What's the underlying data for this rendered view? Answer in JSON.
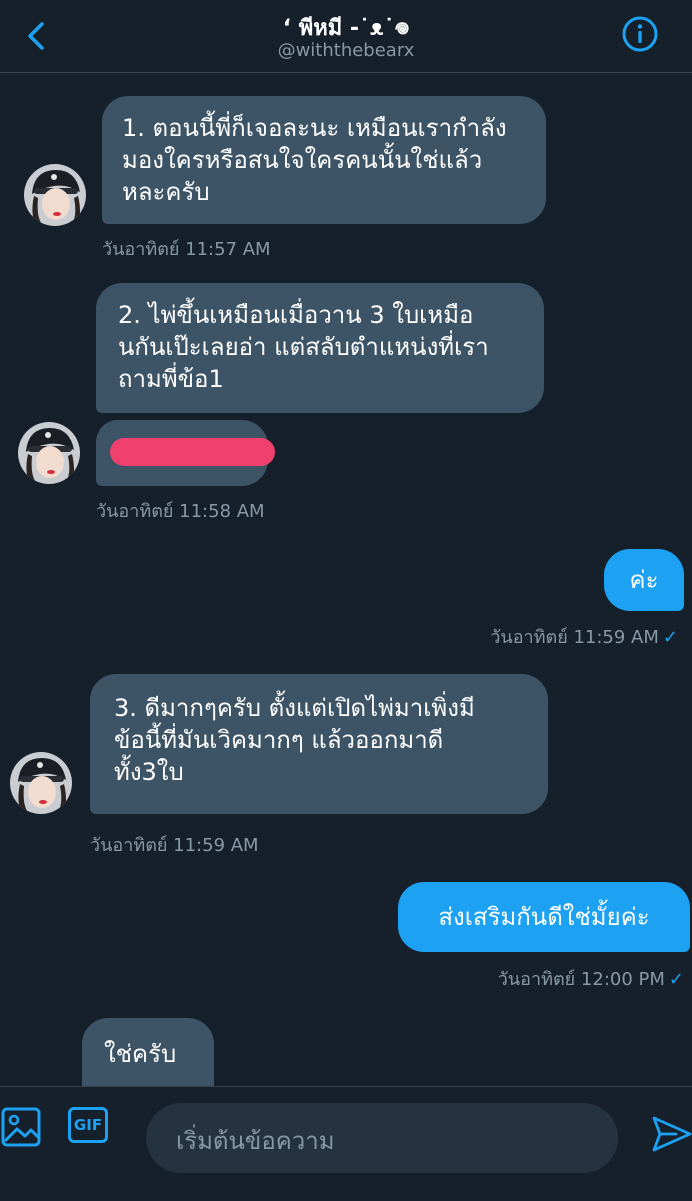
{
  "header": {
    "title": "ʻ พีหมี -˙ᴥ˙𖦹",
    "handle": "@withthebearx"
  },
  "messages": [
    {
      "lines": [
        "1. ตอนนี้พี่ก็เจอละนะ เหมือนเรากำลัง",
        "มองใครหรือสนใจใครคนนั้นใช่แล้ว",
        "หละครับ"
      ],
      "timestamp": "วันอาทิตย์ 11:57 AM"
    },
    {
      "lines": [
        "2. ไพ่ขึ้นเหมือนเมื่อวาน 3 ใบเหมือ",
        "นกันเป๊ะเลยอ่า แต่สลับตำแหน่งที่เรา",
        "ถามพี่ข้อ1"
      ],
      "timestamp": "วันอาทิตย์ 11:58 AM"
    },
    {
      "lines": [
        "ค่ะ"
      ],
      "timestamp": "วันอาทิตย์ 11:59 AM"
    },
    {
      "lines": [
        "3. ดีมากๆครับ ตั้งแต่เปิดไพ่มาเพิ่งมี",
        "ข้อนี้ที่มันเวิคมากๆ แล้วออกมาดี",
        "ทั้ง3ใบ"
      ],
      "timestamp": "วันอาทิตย์ 11:59 AM"
    },
    {
      "lines": [
        "ส่งเสริมกันดีใช่มั้ยค่ะ"
      ],
      "timestamp": "วันอาทิตย์ 12:00 PM"
    },
    {
      "lines": [
        "ใช่ครับ"
      ]
    }
  ],
  "read_check": "✓",
  "composer": {
    "gif_label": "GIF",
    "placeholder": "เริ่มต้นข้อความ"
  },
  "colors": {
    "background": "#15202b",
    "incoming_bubble": "#3d5466",
    "outgoing_bubble": "#1da1f2",
    "accent": "#1da1f2",
    "muted_text": "#8899a6",
    "redaction": "#f0406e"
  },
  "icons": {
    "back": "chevron-left-icon",
    "info": "info-icon",
    "image": "image-icon",
    "send": "send-icon",
    "avatar": "avatar"
  }
}
